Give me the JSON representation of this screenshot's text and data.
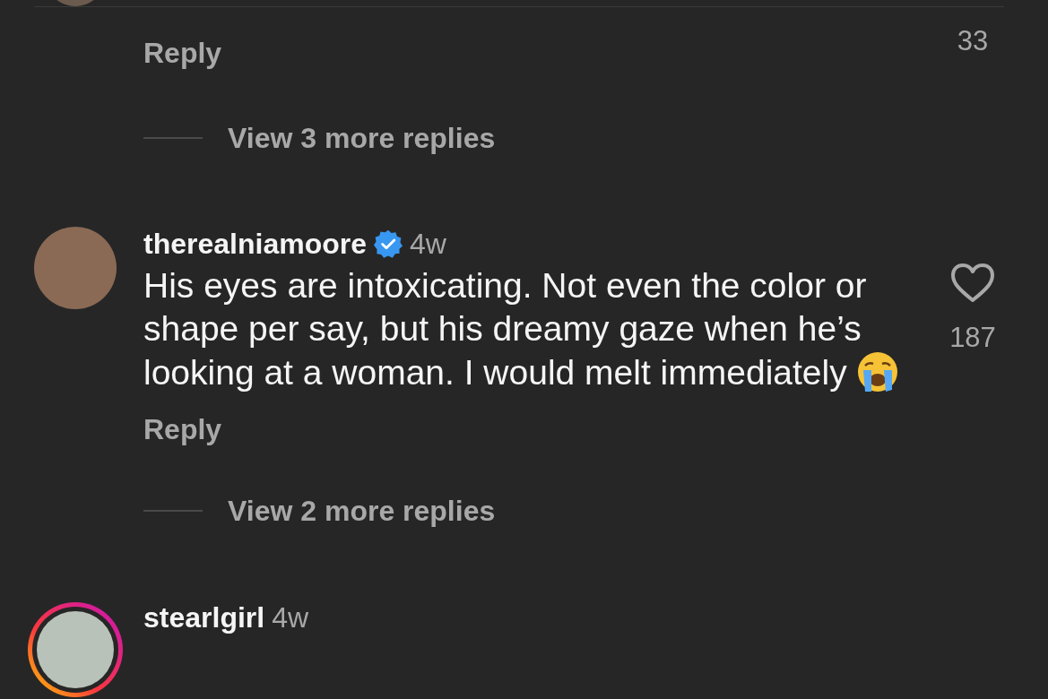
{
  "comments": [
    {
      "reply_label": "Reply",
      "likes": "33",
      "view_replies": "View 3 more replies"
    },
    {
      "username": "therealniamoore",
      "verified": true,
      "time": "4w",
      "text": "His eyes are intoxicating. Not even the color or shape per say, but his dreamy gaze when he’s looking at a woman. I would melt immediately",
      "liked": false,
      "likes": "187",
      "reply_label": "Reply",
      "view_replies": "View 2 more replies"
    },
    {
      "username": "stearlgirl",
      "verified": false,
      "time": "4w",
      "story_ring": true
    }
  ]
}
